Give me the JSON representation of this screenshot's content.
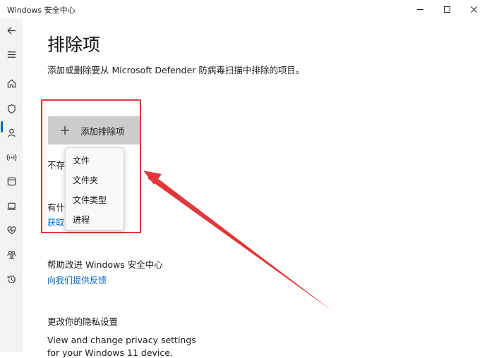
{
  "window": {
    "title": "Windows 安全中心",
    "controls": [
      "minimize",
      "maximize",
      "close"
    ]
  },
  "sidebar": {
    "items": [
      {
        "icon": "back-arrow-icon"
      },
      {
        "icon": "hamburger-menu-icon"
      },
      {
        "icon": "home-icon"
      },
      {
        "icon": "shield-icon",
        "active": true
      },
      {
        "icon": "person-icon"
      },
      {
        "icon": "wifi-signal-icon"
      },
      {
        "icon": "app-browser-icon"
      },
      {
        "icon": "laptop-icon"
      },
      {
        "icon": "heart-pulse-icon"
      },
      {
        "icon": "family-icon"
      },
      {
        "icon": "history-icon"
      }
    ],
    "accent": "#0067c0"
  },
  "main": {
    "title": "排除项",
    "description": "添加或删除要从 Microsoft Defender 防病毒扫描中排除的项目。",
    "add_button": "添加排除项",
    "no_exclusions_partial": "不存",
    "question_partial": "有什",
    "get_help_partial": "获取",
    "improve": {
      "heading": "帮助改进 Windows 安全中心",
      "link": "向我们提供反馈"
    },
    "privacy": {
      "heading": "更改你的隐私设置",
      "line1": "View and change privacy settings",
      "line2": "for your Windows 11 device."
    }
  },
  "dropdown": {
    "items": [
      "文件",
      "文件夹",
      "文件类型",
      "进程"
    ]
  },
  "annotation": {
    "color": "#e0383a"
  }
}
